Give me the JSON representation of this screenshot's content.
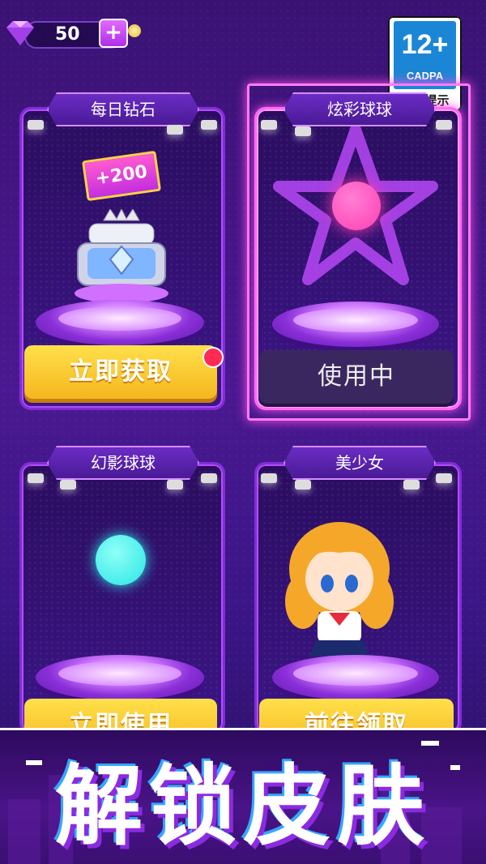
{
  "topbar": {
    "gem_icon": "diamond-icon",
    "gem_count": "50",
    "plus_label": "+"
  },
  "age_badge": {
    "rating": "12+",
    "org": "CADPA",
    "label": "适龄提示"
  },
  "cards": [
    {
      "title": "每日钻石",
      "reward": "+200",
      "button": "立即获取",
      "has_notification": true
    },
    {
      "title": "炫彩球球",
      "button": "使用中",
      "selected": true,
      "orb_color": "#ff3fb4"
    },
    {
      "title": "幻影球球",
      "button": "立即使用",
      "orb_color": "#29e6e6"
    },
    {
      "title": "美少女",
      "button": "前往领取"
    }
  ],
  "banner": {
    "title": "解锁皮肤"
  },
  "colors": {
    "accent": "#b64aff",
    "button_yellow": "#f5b61e",
    "selected_glow": "#ff4de8"
  }
}
